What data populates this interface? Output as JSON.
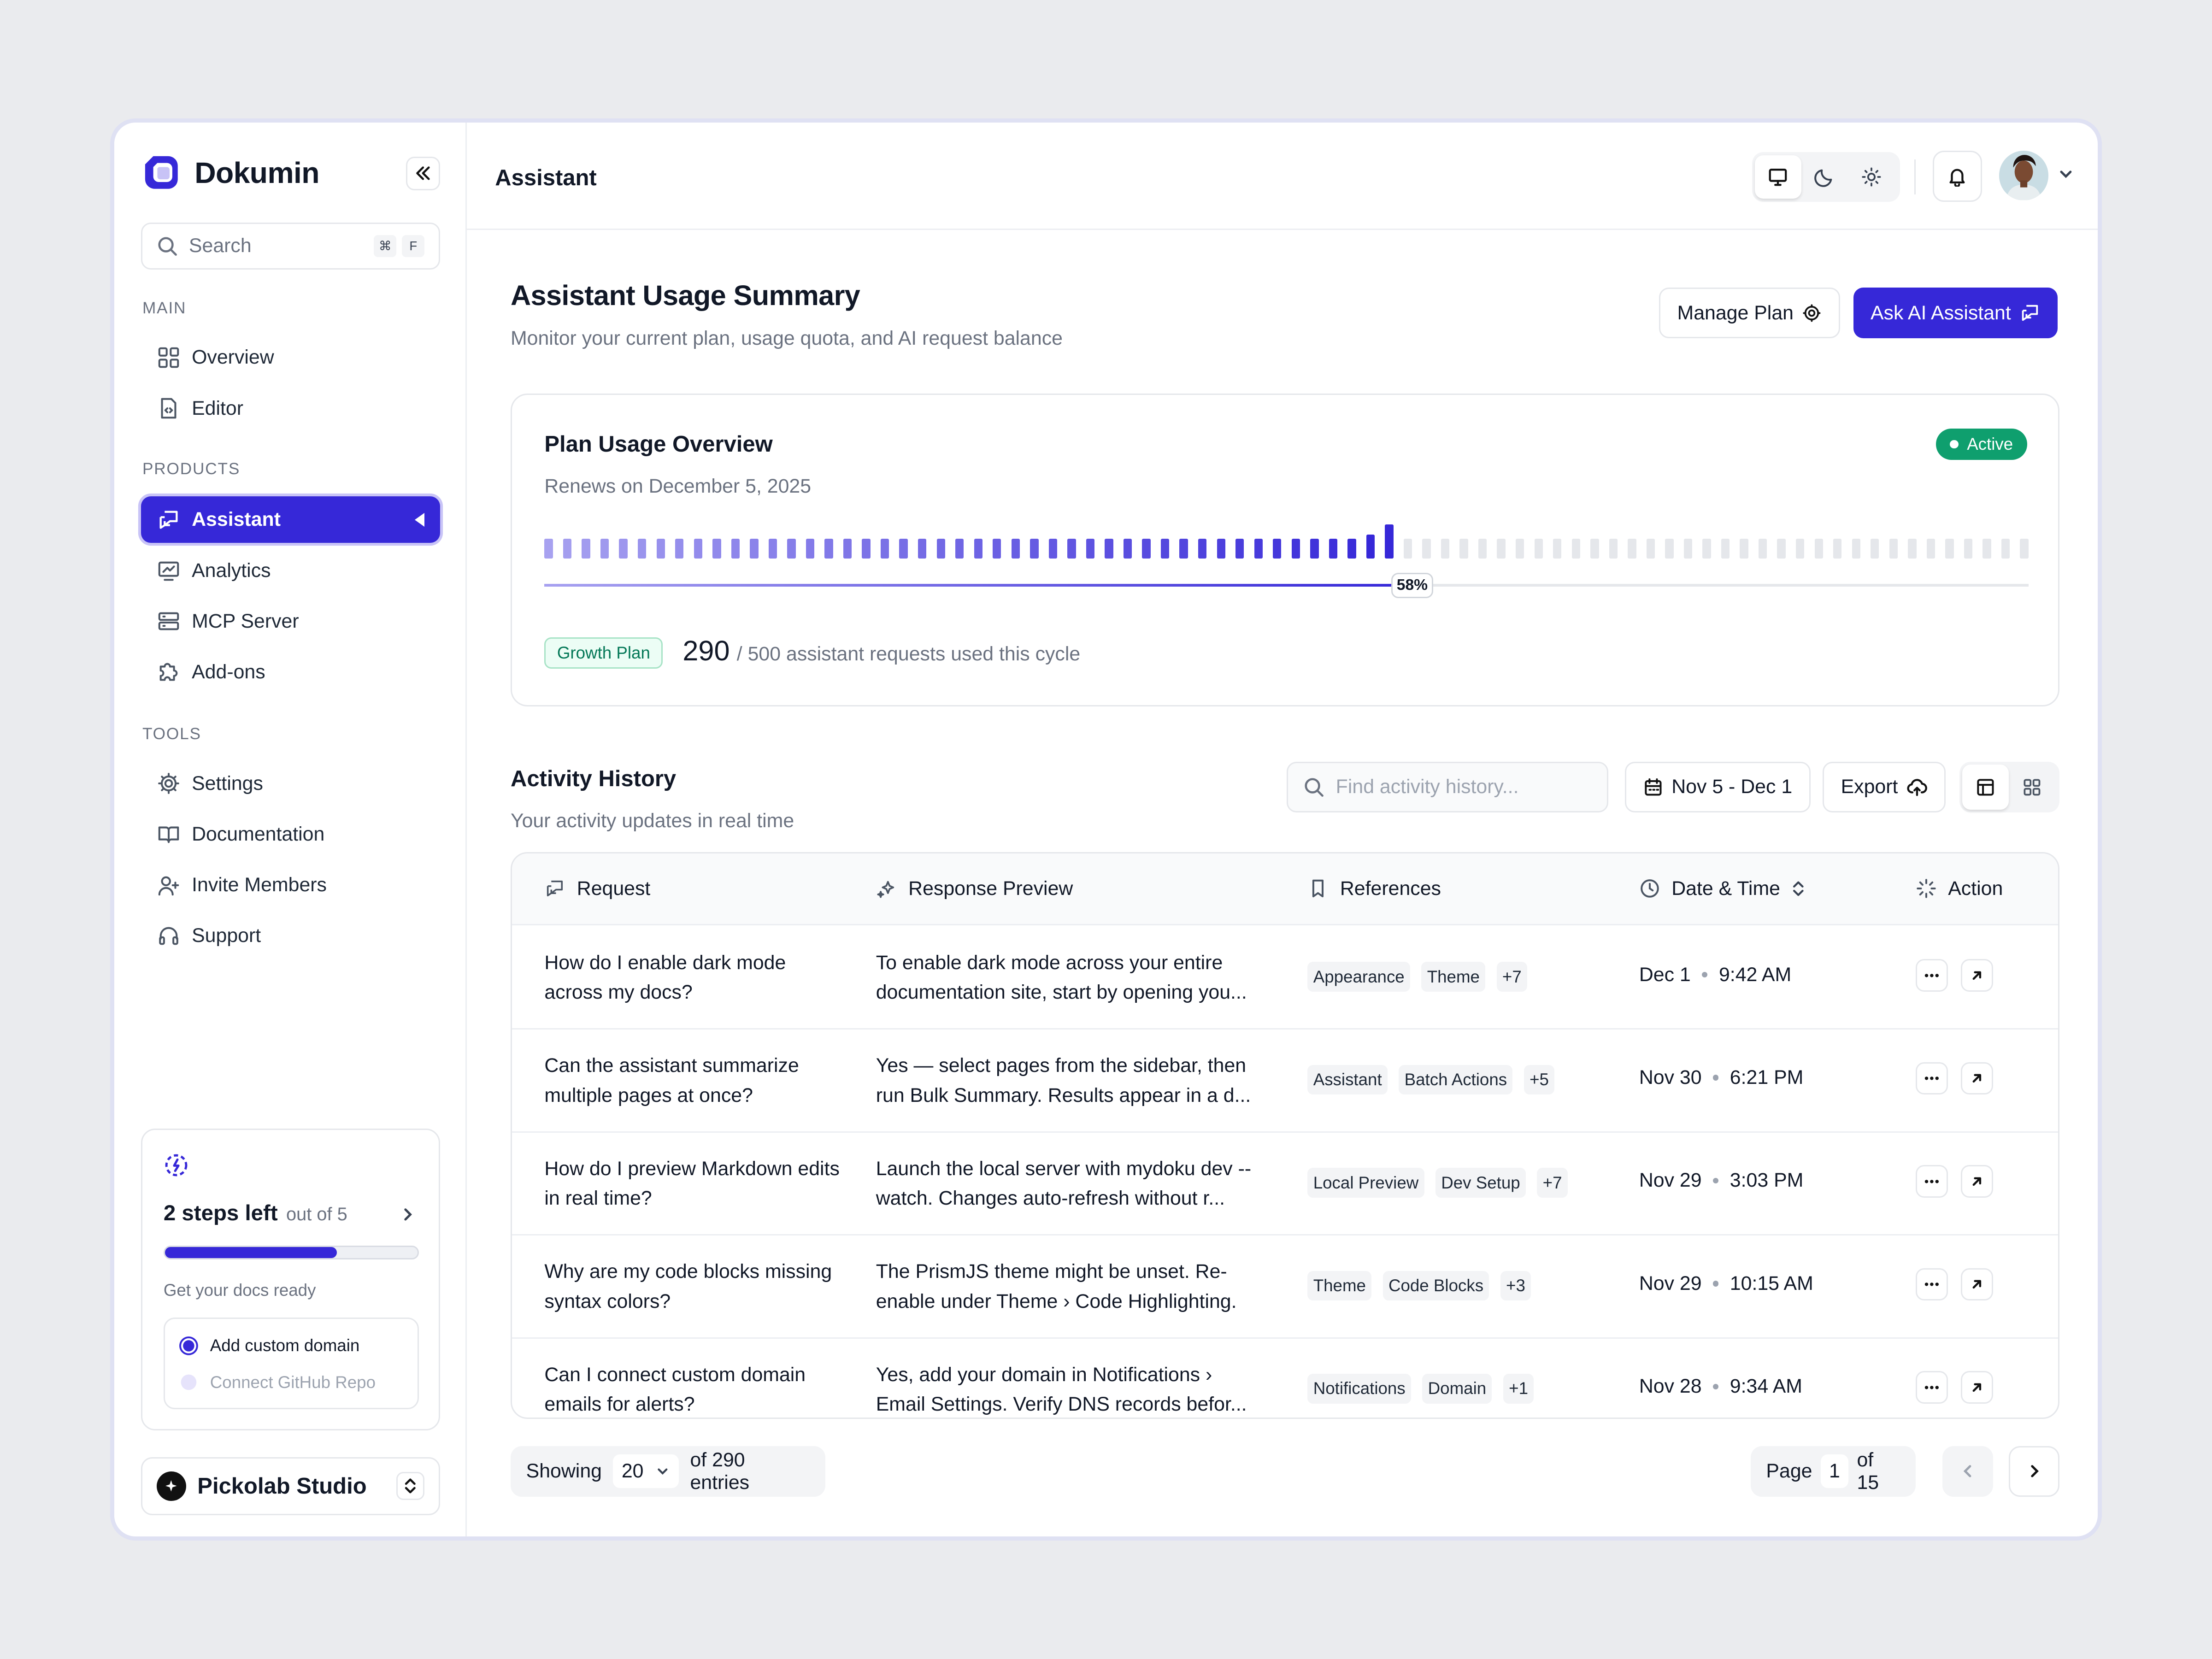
{
  "brand": {
    "name": "Dokumin"
  },
  "sidebar": {
    "search_placeholder": "Search",
    "search_shortcut": [
      "⌘",
      "F"
    ],
    "sections": {
      "main": "MAIN",
      "products": "PRODUCTS",
      "tools": "TOOLS"
    },
    "main_items": [
      {
        "label": "Overview",
        "icon": "grid-icon"
      },
      {
        "label": "Editor",
        "icon": "file-code-icon"
      }
    ],
    "product_items": [
      {
        "label": "Assistant",
        "icon": "chat-icon",
        "active": true
      },
      {
        "label": "Analytics",
        "icon": "chart-icon"
      },
      {
        "label": "MCP Server",
        "icon": "server-icon"
      },
      {
        "label": "Add-ons",
        "icon": "puzzle-icon"
      }
    ],
    "tool_items": [
      {
        "label": "Settings",
        "icon": "gear-icon"
      },
      {
        "label": "Documentation",
        "icon": "book-icon"
      },
      {
        "label": "Invite Members",
        "icon": "user-plus-icon"
      },
      {
        "label": "Support",
        "icon": "headset-icon"
      }
    ],
    "onboarding": {
      "steps_left": "2 steps left",
      "out_of": "out of 5",
      "progress": 0.68,
      "subtitle": "Get your docs ready",
      "tasks": [
        "Add custom domain",
        "Connect GitHub Repo"
      ]
    },
    "workspace": {
      "name": "Pickolab Studio"
    }
  },
  "topbar": {
    "title": "Assistant"
  },
  "header": {
    "title": "Assistant Usage Summary",
    "subtitle": "Monitor your current plan, usage quota, and AI request balance",
    "manage_plan": "Manage Plan",
    "ask_ai": "Ask AI Assistant"
  },
  "plan": {
    "title": "Plan Usage Overview",
    "status": "Active",
    "renews": "Renews on December 5, 2025",
    "percent": 58,
    "percent_label": "58%",
    "plan_name": "Growth Plan",
    "used": "290",
    "used_rest": "/ 500 assistant requests used this cycle"
  },
  "activity": {
    "title": "Activity History",
    "subtitle": "Your activity updates in real time",
    "search_placeholder": "Find activity history...",
    "date_range": "Nov 5 - Dec 1",
    "export": "Export",
    "columns": [
      "Request",
      "Response Preview",
      "References",
      "Date & Time",
      "Action"
    ],
    "rows": [
      {
        "request": "How do I enable dark mode across my docs?",
        "response": "To enable dark mode across your entire documentation site, start by opening you...",
        "tags": [
          "Appearance",
          "Theme",
          "+7"
        ],
        "date": "Dec 1",
        "time": "9:42 AM"
      },
      {
        "request": "Can the assistant summarize multiple pages at once?",
        "response": "Yes — select pages from the sidebar, then run Bulk Summary. Results appear in a d...",
        "tags": [
          "Assistant",
          "Batch Actions",
          "+5"
        ],
        "date": "Nov 30",
        "time": "6:21 PM"
      },
      {
        "request": "How do I preview Markdown edits in real time?",
        "response": "Launch the local server with mydoku dev --watch. Changes auto-refresh without r...",
        "tags": [
          "Local Preview",
          "Dev Setup",
          "+7"
        ],
        "date": "Nov 29",
        "time": "3:03 PM"
      },
      {
        "request": "Why are my code blocks missing syntax colors?",
        "response": "The PrismJS theme might be unset. Re-enable under Theme › Code Highlighting.",
        "tags": [
          "Theme",
          "Code Blocks",
          "+3"
        ],
        "date": "Nov 29",
        "time": "10:15 AM"
      },
      {
        "request": "Can I connect custom domain emails for alerts?",
        "response": "Yes, add your domain in Notifications › Email Settings. Verify DNS records befor...",
        "tags": [
          "Notifications",
          "Domain",
          "+1"
        ],
        "date": "Nov 28",
        "time": "9:34 AM"
      }
    ],
    "footer": {
      "showing": "Showing",
      "page_size": "20",
      "of_entries": "of 290 entries",
      "page": "Page",
      "page_num": "1",
      "of_pages": "of 15"
    }
  },
  "colors": {
    "accent": "#3628d8",
    "active_badge": "#0f9f6e"
  }
}
